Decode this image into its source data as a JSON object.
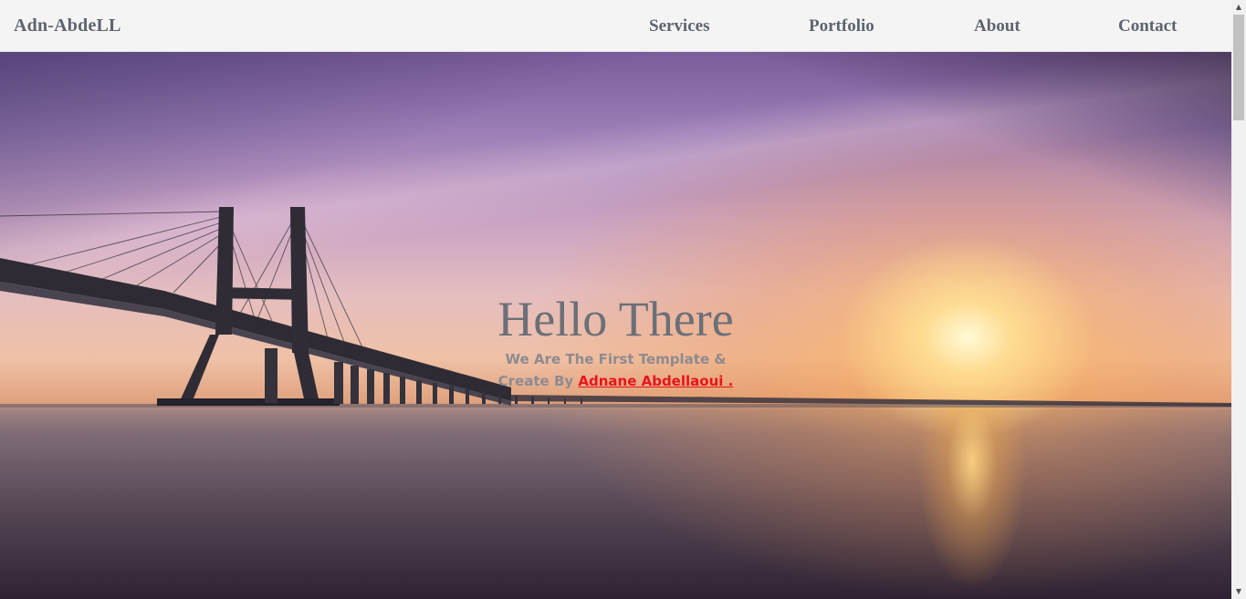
{
  "brand": {
    "name": "Adn-AbdeLL"
  },
  "nav": {
    "items": [
      {
        "label": "Services"
      },
      {
        "label": "Portfolio"
      },
      {
        "label": "About"
      },
      {
        "label": "Contact"
      }
    ]
  },
  "hero": {
    "title": "Hello There",
    "subtitle_line1": "We Are The First Template &",
    "subtitle_prefix": "Create By ",
    "author_link": "Adnane Abdellaoui ."
  },
  "colors": {
    "nav_background": "#f4f4f4",
    "nav_text": "#5d6470",
    "title_text": "#6b6f78",
    "subtitle_text": "#8e8a90",
    "author_link": "#e8141c"
  },
  "icons": {
    "scroll_up": "triangle-up-icon",
    "scroll_down": "triangle-down-icon"
  }
}
